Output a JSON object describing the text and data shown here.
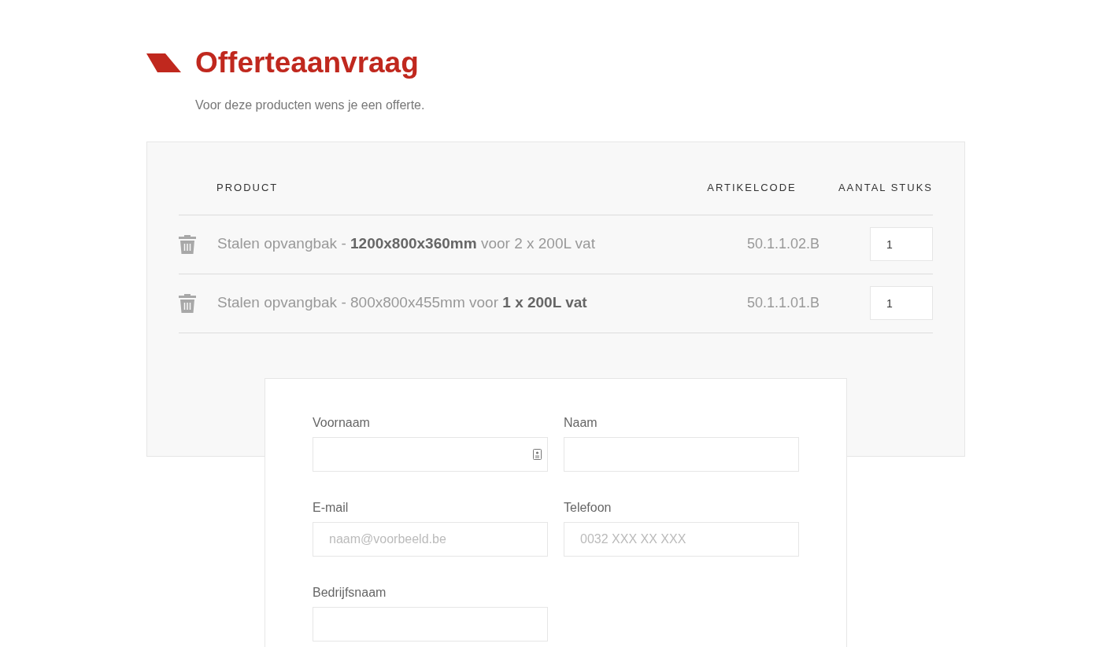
{
  "heading": {
    "title": "Offerteaanvraag",
    "subtitle": "Voor deze producten wens je een offerte."
  },
  "table": {
    "columns": [
      "PRODUCT",
      "ARTIKELCODE",
      "AANTAL STUKS"
    ],
    "rows": [
      {
        "product": "Stalen opvangbak - **1200x800x360mm** voor 2 x 200L vat",
        "code": "50.1.1.02.B",
        "quantity": "1"
      },
      {
        "product": "Stalen opvangbak - 800x800x455mm voor **1 x 200L vat**",
        "code": "50.1.1.01.B",
        "quantity": "1"
      }
    ]
  },
  "form": {
    "fields": [
      {
        "label": "Voornaam",
        "autofill_icon": true
      },
      {
        "label": "Naam",
        "autofill_icon": false
      },
      {
        "label": "E-mail",
        "placeholder": "naam@voorbeeld.be",
        "autofill_icon": false
      },
      {
        "label": "Telefoon",
        "placeholder": "0032 XXX XX XXX",
        "autofill_icon": false
      },
      {
        "label": "Bedrijfsnaam",
        "autofill_icon": false
      }
    ]
  }
}
